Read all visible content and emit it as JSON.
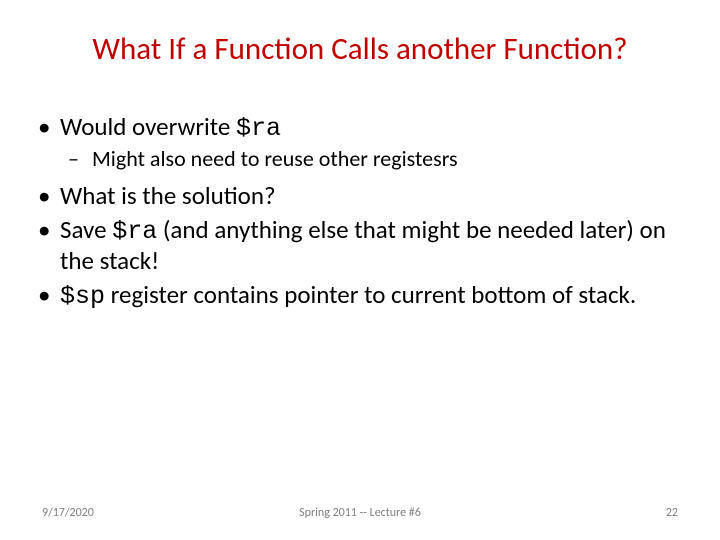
{
  "title": "What If a Function Calls another Function?",
  "bullets": {
    "b1_pre": "Would overwrite ",
    "b1_code": "$ra",
    "b1_sub": "Might also need to reuse other registesrs",
    "b2": "What is the solution?",
    "b3_pre": "Save ",
    "b3_code": "$ra",
    "b3_post": " (and anything else that might be needed later) on the stack!",
    "b4_code": "$sp",
    "b4_post": " register contains pointer to current bottom of stack."
  },
  "footer": {
    "date": "9/17/2020",
    "center": "Spring 2011 -- Lecture #6",
    "pagenum": "22"
  }
}
